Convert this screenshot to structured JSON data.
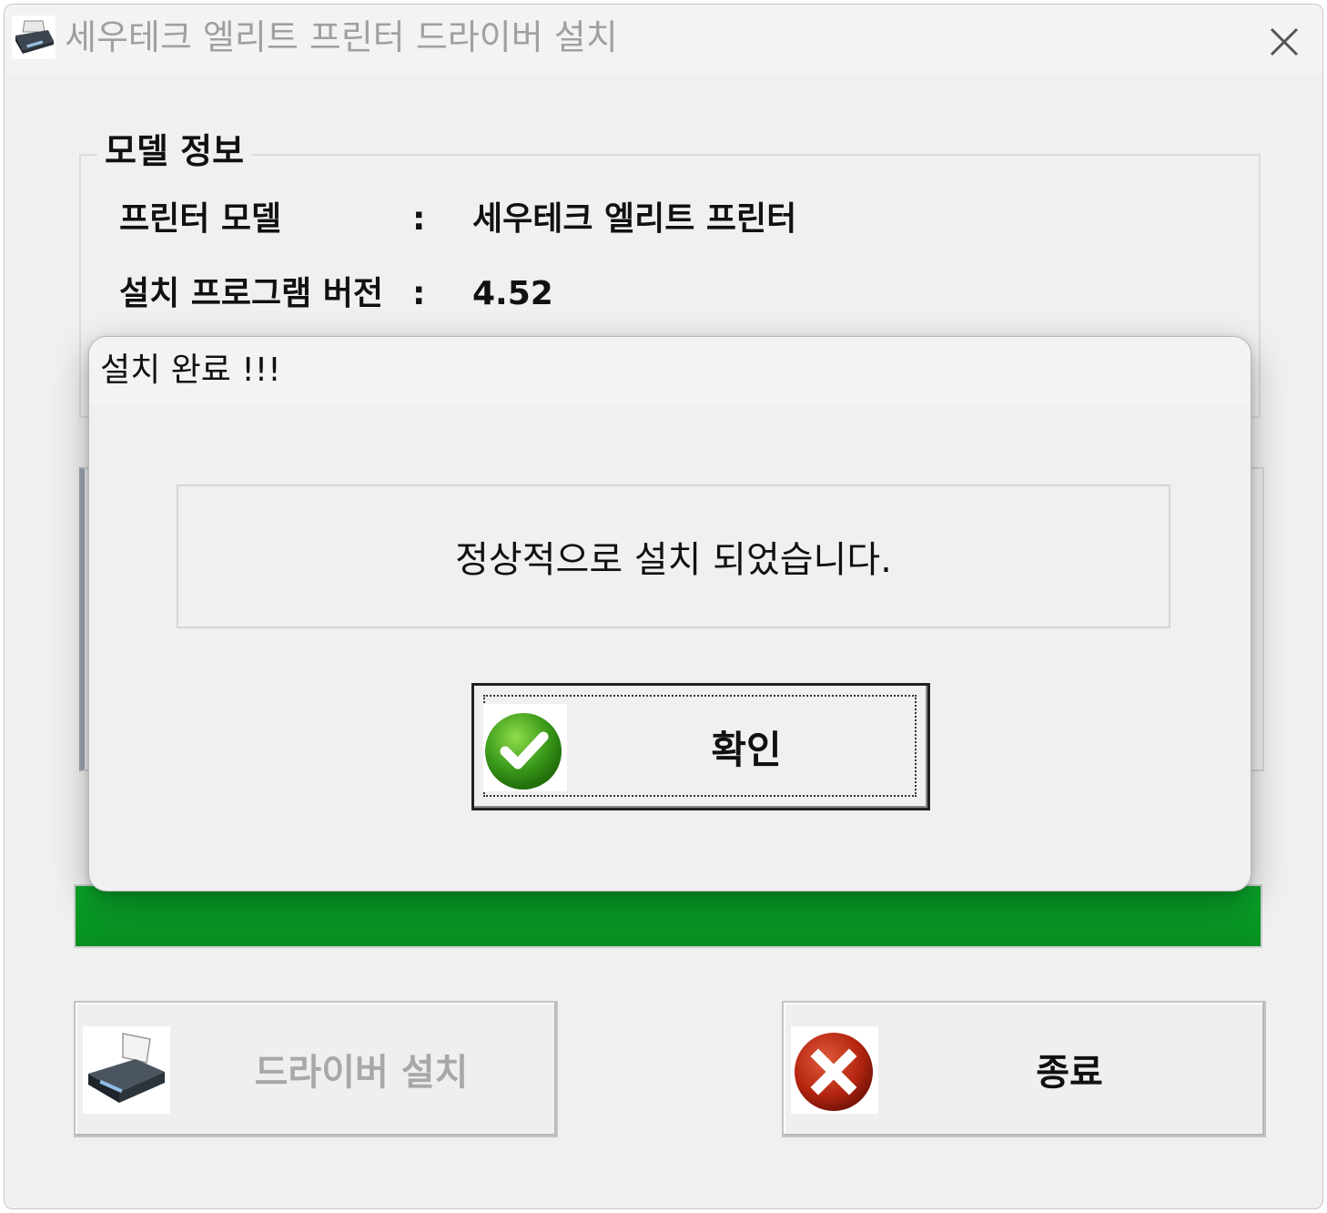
{
  "window": {
    "title": "세우테크 엘리트 프린터 드라이버 설치",
    "icon": "printer-icon",
    "close_icon": "close-icon"
  },
  "model_info": {
    "group_title": "모델 정보",
    "rows": [
      {
        "label": "프린터 모델",
        "separator": ":",
        "value": "세우테크 엘리트 프린터"
      },
      {
        "label": "설치 프로그램 버전",
        "separator": ":",
        "value": "4.52"
      }
    ]
  },
  "progress": {
    "percent": 100,
    "color": "#0a9a26"
  },
  "buttons": {
    "install": {
      "label": "드라이버 설치",
      "icon": "printer-icon",
      "enabled": false
    },
    "exit": {
      "label": "종료",
      "icon": "red-x-icon",
      "enabled": true
    }
  },
  "dialog": {
    "title": "설치 완료 !!!",
    "message": "정상적으로 설치 되었습니다.",
    "ok_label": "확인",
    "ok_icon": "green-check-icon"
  }
}
